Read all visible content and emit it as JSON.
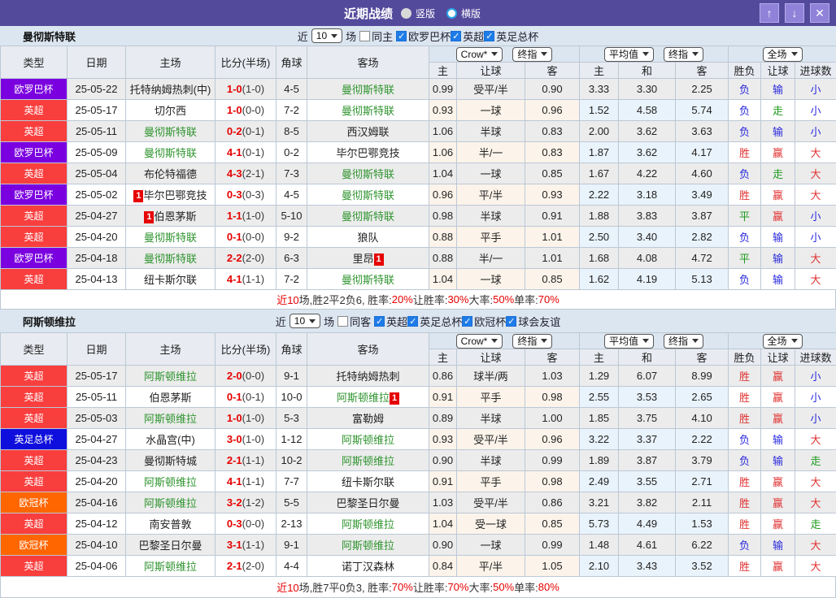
{
  "header": {
    "title": "近期战绩",
    "radios": [
      {
        "label": "竖版",
        "selected": "1"
      },
      {
        "label": "横版",
        "selected": "0"
      }
    ],
    "up": "↑",
    "down": "↓",
    "close": "✕"
  },
  "columns": {
    "type": "类型",
    "date": "日期",
    "home": "主场",
    "score": "比分(半场)",
    "corner": "角球",
    "away": "客场",
    "let_home": "主",
    "let_line": "让球",
    "let_away": "客",
    "avg_home": "主",
    "avg_draw": "和",
    "avg_away": "客",
    "outcome": "胜负",
    "handicap": "让球",
    "goals": "进球数"
  },
  "sections": [
    {
      "team": "曼彻斯特联",
      "filter": {
        "near": "近",
        "count": "10",
        "unit": "场",
        "same": {
          "label": "同主",
          "on": "0"
        },
        "leagues": [
          {
            "label": "欧罗巴杯",
            "on": "1"
          },
          {
            "label": "英超",
            "on": "1"
          },
          {
            "label": "英足总杯",
            "on": "1"
          }
        ]
      },
      "selects": {
        "company": "Crow*",
        "company_stage": "终指",
        "europe": "平均值",
        "europe_stage": "终指",
        "scope": "全场"
      },
      "rows": [
        {
          "type": "欧罗巴杯",
          "type_cls": "europa",
          "date": "25-05-22",
          "home": {
            "name": "托特纳姆热刺(中)",
            "self": "0"
          },
          "score_ft": "1-0",
          "score_ht": "(1-0)",
          "corners": "4-5",
          "away": {
            "name": "曼彻斯特联",
            "self": "1"
          },
          "let_home": "0.99",
          "let_line": "受平/半",
          "let_away": "0.90",
          "avg_home": "3.33",
          "avg_draw": "3.30",
          "avg_away": "2.25",
          "outcome": {
            "t": "负",
            "c": "l"
          },
          "handicap": {
            "t": "输",
            "c": "l"
          },
          "goals": {
            "t": "小",
            "c": "l"
          }
        },
        {
          "type": "英超",
          "type_cls": "epl",
          "date": "25-05-17",
          "home": {
            "name": "切尔西",
            "self": "0"
          },
          "score_ft": "1-0",
          "score_ht": "(0-0)",
          "corners": "7-2",
          "away": {
            "name": "曼彻斯特联",
            "self": "1"
          },
          "let_home": "0.93",
          "let_line": "一球",
          "let_away": "0.96",
          "avg_home": "1.52",
          "avg_draw": "4.58",
          "avg_away": "5.74",
          "outcome": {
            "t": "负",
            "c": "l"
          },
          "handicap": {
            "t": "走",
            "c": "d"
          },
          "goals": {
            "t": "小",
            "c": "l"
          }
        },
        {
          "type": "英超",
          "type_cls": "epl",
          "date": "25-05-11",
          "home": {
            "name": "曼彻斯特联",
            "self": "1"
          },
          "score_ft": "0-2",
          "score_ht": "(0-1)",
          "corners": "8-5",
          "away": {
            "name": "西汉姆联",
            "self": "0"
          },
          "let_home": "1.06",
          "let_line": "半球",
          "let_away": "0.83",
          "avg_home": "2.00",
          "avg_draw": "3.62",
          "avg_away": "3.63",
          "outcome": {
            "t": "负",
            "c": "l"
          },
          "handicap": {
            "t": "输",
            "c": "l"
          },
          "goals": {
            "t": "小",
            "c": "l"
          }
        },
        {
          "type": "欧罗巴杯",
          "type_cls": "europa",
          "date": "25-05-09",
          "home": {
            "name": "曼彻斯特联",
            "self": "1"
          },
          "score_ft": "4-1",
          "score_ht": "(0-1)",
          "corners": "0-2",
          "away": {
            "name": "毕尔巴鄂竞技",
            "self": "0"
          },
          "let_home": "1.06",
          "let_line": "半/一",
          "let_away": "0.83",
          "avg_home": "1.87",
          "avg_draw": "3.62",
          "avg_away": "4.17",
          "outcome": {
            "t": "胜",
            "c": "w"
          },
          "handicap": {
            "t": "赢",
            "c": "w"
          },
          "goals": {
            "t": "大",
            "c": "w"
          }
        },
        {
          "type": "英超",
          "type_cls": "epl",
          "date": "25-05-04",
          "home": {
            "name": "布伦特福德",
            "self": "0"
          },
          "score_ft": "4-3",
          "score_ht": "(2-1)",
          "corners": "7-3",
          "away": {
            "name": "曼彻斯特联",
            "self": "1"
          },
          "let_home": "1.04",
          "let_line": "一球",
          "let_away": "0.85",
          "avg_home": "1.67",
          "avg_draw": "4.22",
          "avg_away": "4.60",
          "outcome": {
            "t": "负",
            "c": "l"
          },
          "handicap": {
            "t": "走",
            "c": "d"
          },
          "goals": {
            "t": "大",
            "c": "w"
          }
        },
        {
          "type": "欧罗巴杯",
          "type_cls": "europa",
          "date": "25-05-02",
          "home": {
            "name": "毕尔巴鄂竞技",
            "self": "0",
            "rc_left": "1"
          },
          "score_ft": "0-3",
          "score_ht": "(0-3)",
          "corners": "4-5",
          "away": {
            "name": "曼彻斯特联",
            "self": "1"
          },
          "let_home": "0.96",
          "let_line": "平/半",
          "let_away": "0.93",
          "avg_home": "2.22",
          "avg_draw": "3.18",
          "avg_away": "3.49",
          "outcome": {
            "t": "胜",
            "c": "w"
          },
          "handicap": {
            "t": "赢",
            "c": "w"
          },
          "goals": {
            "t": "大",
            "c": "w"
          }
        },
        {
          "type": "英超",
          "type_cls": "epl",
          "date": "25-04-27",
          "home": {
            "name": "伯恩茅斯",
            "self": "0",
            "rc_left": "1"
          },
          "score_ft": "1-1",
          "score_ht": "(1-0)",
          "corners": "5-10",
          "away": {
            "name": "曼彻斯特联",
            "self": "1"
          },
          "let_home": "0.98",
          "let_line": "半球",
          "let_away": "0.91",
          "avg_home": "1.88",
          "avg_draw": "3.83",
          "avg_away": "3.87",
          "outcome": {
            "t": "平",
            "c": "d"
          },
          "handicap": {
            "t": "赢",
            "c": "w"
          },
          "goals": {
            "t": "小",
            "c": "l"
          }
        },
        {
          "type": "英超",
          "type_cls": "epl",
          "date": "25-04-20",
          "home": {
            "name": "曼彻斯特联",
            "self": "1"
          },
          "score_ft": "0-1",
          "score_ht": "(0-0)",
          "corners": "9-2",
          "away": {
            "name": "狼队",
            "self": "0"
          },
          "let_home": "0.88",
          "let_line": "平手",
          "let_away": "1.01",
          "avg_home": "2.50",
          "avg_draw": "3.40",
          "avg_away": "2.82",
          "outcome": {
            "t": "负",
            "c": "l"
          },
          "handicap": {
            "t": "输",
            "c": "l"
          },
          "goals": {
            "t": "小",
            "c": "l"
          }
        },
        {
          "type": "欧罗巴杯",
          "type_cls": "europa",
          "date": "25-04-18",
          "home": {
            "name": "曼彻斯特联",
            "self": "1"
          },
          "score_ft": "2-2",
          "score_ht": "(2-0)",
          "corners": "6-3",
          "away": {
            "name": "里昂",
            "self": "0",
            "rc_right": "1"
          },
          "let_home": "0.88",
          "let_line": "半/一",
          "let_away": "1.01",
          "avg_home": "1.68",
          "avg_draw": "4.08",
          "avg_away": "4.72",
          "outcome": {
            "t": "平",
            "c": "d"
          },
          "handicap": {
            "t": "输",
            "c": "l"
          },
          "goals": {
            "t": "大",
            "c": "w"
          }
        },
        {
          "type": "英超",
          "type_cls": "epl",
          "date": "25-04-13",
          "home": {
            "name": "纽卡斯尔联",
            "self": "0"
          },
          "score_ft": "4-1",
          "score_ht": "(1-1)",
          "corners": "7-2",
          "away": {
            "name": "曼彻斯特联",
            "self": "1"
          },
          "let_home": "1.04",
          "let_line": "一球",
          "let_away": "0.85",
          "avg_home": "1.62",
          "avg_draw": "4.19",
          "avg_away": "5.13",
          "outcome": {
            "t": "负",
            "c": "l"
          },
          "handicap": {
            "t": "输",
            "c": "l"
          },
          "goals": {
            "t": "大",
            "c": "w"
          }
        }
      ],
      "summary": [
        {
          "t": "近10",
          "r": "1"
        },
        {
          "t": "场,胜2平2负6, 胜率:",
          "r": "0"
        },
        {
          "t": "20%",
          "r": "1"
        },
        {
          "t": " 让胜率:",
          "r": "0"
        },
        {
          "t": "30%",
          "r": "1"
        },
        {
          "t": " 大率:",
          "r": "0"
        },
        {
          "t": "50%",
          "r": "1"
        },
        {
          "t": " 单率:",
          "r": "0"
        },
        {
          "t": "70%",
          "r": "1"
        }
      ]
    },
    {
      "team": "阿斯顿维拉",
      "filter": {
        "near": "近",
        "count": "10",
        "unit": "场",
        "same": {
          "label": "同客",
          "on": "0"
        },
        "leagues": [
          {
            "label": "英超",
            "on": "1"
          },
          {
            "label": "英足总杯",
            "on": "1"
          },
          {
            "label": "欧冠杯",
            "on": "1"
          },
          {
            "label": "球会友谊",
            "on": "1"
          }
        ]
      },
      "selects": {
        "company": "Crow*",
        "company_stage": "终指",
        "europe": "平均值",
        "europe_stage": "终指",
        "scope": "全场"
      },
      "rows": [
        {
          "type": "英超",
          "type_cls": "epl",
          "date": "25-05-17",
          "home": {
            "name": "阿斯顿维拉",
            "self": "1"
          },
          "score_ft": "2-0",
          "score_ht": "(0-0)",
          "corners": "9-1",
          "away": {
            "name": "托特纳姆热刺",
            "self": "0"
          },
          "let_home": "0.86",
          "let_line": "球半/两",
          "let_away": "1.03",
          "avg_home": "1.29",
          "avg_draw": "6.07",
          "avg_away": "8.99",
          "outcome": {
            "t": "胜",
            "c": "w"
          },
          "handicap": {
            "t": "赢",
            "c": "w"
          },
          "goals": {
            "t": "小",
            "c": "l"
          }
        },
        {
          "type": "英超",
          "type_cls": "epl",
          "date": "25-05-11",
          "home": {
            "name": "伯恩茅斯",
            "self": "0"
          },
          "score_ft": "0-1",
          "score_ht": "(0-1)",
          "corners": "10-0",
          "away": {
            "name": "阿斯顿维拉",
            "self": "1",
            "rc_right": "1"
          },
          "let_home": "0.91",
          "let_line": "平手",
          "let_away": "0.98",
          "avg_home": "2.55",
          "avg_draw": "3.53",
          "avg_away": "2.65",
          "outcome": {
            "t": "胜",
            "c": "w"
          },
          "handicap": {
            "t": "赢",
            "c": "w"
          },
          "goals": {
            "t": "小",
            "c": "l"
          }
        },
        {
          "type": "英超",
          "type_cls": "epl",
          "date": "25-05-03",
          "home": {
            "name": "阿斯顿维拉",
            "self": "1"
          },
          "score_ft": "1-0",
          "score_ht": "(1-0)",
          "corners": "5-3",
          "away": {
            "name": "富勒姆",
            "self": "0"
          },
          "let_home": "0.89",
          "let_line": "半球",
          "let_away": "1.00",
          "avg_home": "1.85",
          "avg_draw": "3.75",
          "avg_away": "4.10",
          "outcome": {
            "t": "胜",
            "c": "w"
          },
          "handicap": {
            "t": "赢",
            "c": "w"
          },
          "goals": {
            "t": "小",
            "c": "l"
          }
        },
        {
          "type": "英足总杯",
          "type_cls": "facup",
          "date": "25-04-27",
          "home": {
            "name": "水晶宫(中)",
            "self": "0"
          },
          "score_ft": "3-0",
          "score_ht": "(1-0)",
          "corners": "1-12",
          "away": {
            "name": "阿斯顿维拉",
            "self": "1"
          },
          "let_home": "0.93",
          "let_line": "受平/半",
          "let_away": "0.96",
          "avg_home": "3.22",
          "avg_draw": "3.37",
          "avg_away": "2.22",
          "outcome": {
            "t": "负",
            "c": "l"
          },
          "handicap": {
            "t": "输",
            "c": "l"
          },
          "goals": {
            "t": "大",
            "c": "w"
          }
        },
        {
          "type": "英超",
          "type_cls": "epl",
          "date": "25-04-23",
          "home": {
            "name": "曼彻斯特城",
            "self": "0"
          },
          "score_ft": "2-1",
          "score_ht": "(1-1)",
          "corners": "10-2",
          "away": {
            "name": "阿斯顿维拉",
            "self": "1"
          },
          "let_home": "0.90",
          "let_line": "半球",
          "let_away": "0.99",
          "avg_home": "1.89",
          "avg_draw": "3.87",
          "avg_away": "3.79",
          "outcome": {
            "t": "负",
            "c": "l"
          },
          "handicap": {
            "t": "输",
            "c": "l"
          },
          "goals": {
            "t": "走",
            "c": "d"
          }
        },
        {
          "type": "英超",
          "type_cls": "epl",
          "date": "25-04-20",
          "home": {
            "name": "阿斯顿维拉",
            "self": "1"
          },
          "score_ft": "4-1",
          "score_ht": "(1-1)",
          "corners": "7-7",
          "away": {
            "name": "纽卡斯尔联",
            "self": "0"
          },
          "let_home": "0.91",
          "let_line": "平手",
          "let_away": "0.98",
          "avg_home": "2.49",
          "avg_draw": "3.55",
          "avg_away": "2.71",
          "outcome": {
            "t": "胜",
            "c": "w"
          },
          "handicap": {
            "t": "赢",
            "c": "w"
          },
          "goals": {
            "t": "大",
            "c": "w"
          }
        },
        {
          "type": "欧冠杯",
          "type_cls": "ucl",
          "date": "25-04-16",
          "home": {
            "name": "阿斯顿维拉",
            "self": "1"
          },
          "score_ft": "3-2",
          "score_ht": "(1-2)",
          "corners": "5-5",
          "away": {
            "name": "巴黎圣日尔曼",
            "self": "0"
          },
          "let_home": "1.03",
          "let_line": "受平/半",
          "let_away": "0.86",
          "avg_home": "3.21",
          "avg_draw": "3.82",
          "avg_away": "2.11",
          "outcome": {
            "t": "胜",
            "c": "w"
          },
          "handicap": {
            "t": "赢",
            "c": "w"
          },
          "goals": {
            "t": "大",
            "c": "w"
          }
        },
        {
          "type": "英超",
          "type_cls": "epl",
          "date": "25-04-12",
          "home": {
            "name": "南安普敦",
            "self": "0"
          },
          "score_ft": "0-3",
          "score_ht": "(0-0)",
          "corners": "2-13",
          "away": {
            "name": "阿斯顿维拉",
            "self": "1"
          },
          "let_home": "1.04",
          "let_line": "受一球",
          "let_away": "0.85",
          "avg_home": "5.73",
          "avg_draw": "4.49",
          "avg_away": "1.53",
          "outcome": {
            "t": "胜",
            "c": "w"
          },
          "handicap": {
            "t": "赢",
            "c": "w"
          },
          "goals": {
            "t": "走",
            "c": "d"
          }
        },
        {
          "type": "欧冠杯",
          "type_cls": "ucl",
          "date": "25-04-10",
          "home": {
            "name": "巴黎圣日尔曼",
            "self": "0"
          },
          "score_ft": "3-1",
          "score_ht": "(1-1)",
          "corners": "9-1",
          "away": {
            "name": "阿斯顿维拉",
            "self": "1"
          },
          "let_home": "0.90",
          "let_line": "一球",
          "let_away": "0.99",
          "avg_home": "1.48",
          "avg_draw": "4.61",
          "avg_away": "6.22",
          "outcome": {
            "t": "负",
            "c": "l"
          },
          "handicap": {
            "t": "输",
            "c": "l"
          },
          "goals": {
            "t": "大",
            "c": "w"
          }
        },
        {
          "type": "英超",
          "type_cls": "epl",
          "date": "25-04-06",
          "home": {
            "name": "阿斯顿维拉",
            "self": "1"
          },
          "score_ft": "2-1",
          "score_ht": "(2-0)",
          "corners": "4-4",
          "away": {
            "name": "诺丁汉森林",
            "self": "0"
          },
          "let_home": "0.84",
          "let_line": "平/半",
          "let_away": "1.05",
          "avg_home": "2.10",
          "avg_draw": "3.43",
          "avg_away": "3.52",
          "outcome": {
            "t": "胜",
            "c": "w"
          },
          "handicap": {
            "t": "赢",
            "c": "w"
          },
          "goals": {
            "t": "大",
            "c": "w"
          }
        }
      ],
      "summary": [
        {
          "t": "近10",
          "r": "1"
        },
        {
          "t": "场,胜7平0负3, 胜率:",
          "r": "0"
        },
        {
          "t": "70%",
          "r": "1"
        },
        {
          "t": " 让胜率:",
          "r": "0"
        },
        {
          "t": "70%",
          "r": "1"
        },
        {
          "t": " 大率:",
          "r": "0"
        },
        {
          "t": "50%",
          "r": "1"
        },
        {
          "t": " 单率:",
          "r": "0"
        },
        {
          "t": "80%",
          "r": "1"
        }
      ]
    }
  ]
}
